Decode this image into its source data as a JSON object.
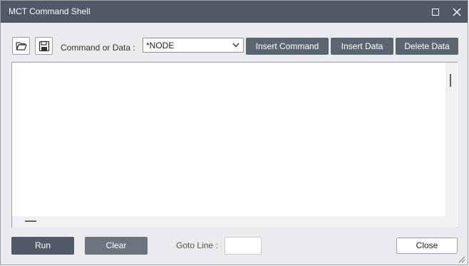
{
  "window": {
    "title": "MCT Command Shell"
  },
  "toolbar": {
    "open_icon": "folder-open-icon",
    "save_icon": "floppy-save-icon",
    "command_label": "Command or Data :",
    "command_select": {
      "selected": "*NODE"
    },
    "insert_command_label": "Insert Command",
    "insert_data_label": "Insert Data",
    "delete_data_label": "Delete Data"
  },
  "editor": {
    "content": ""
  },
  "footer": {
    "run_label": "Run",
    "clear_label": "Clear",
    "goto_label": "Goto Line :",
    "goto_value": "",
    "close_label": "Close"
  },
  "colors": {
    "titlebar": "#4f5a66",
    "button_dark": "#5c6670",
    "dialog_bg": "#eaebee"
  }
}
